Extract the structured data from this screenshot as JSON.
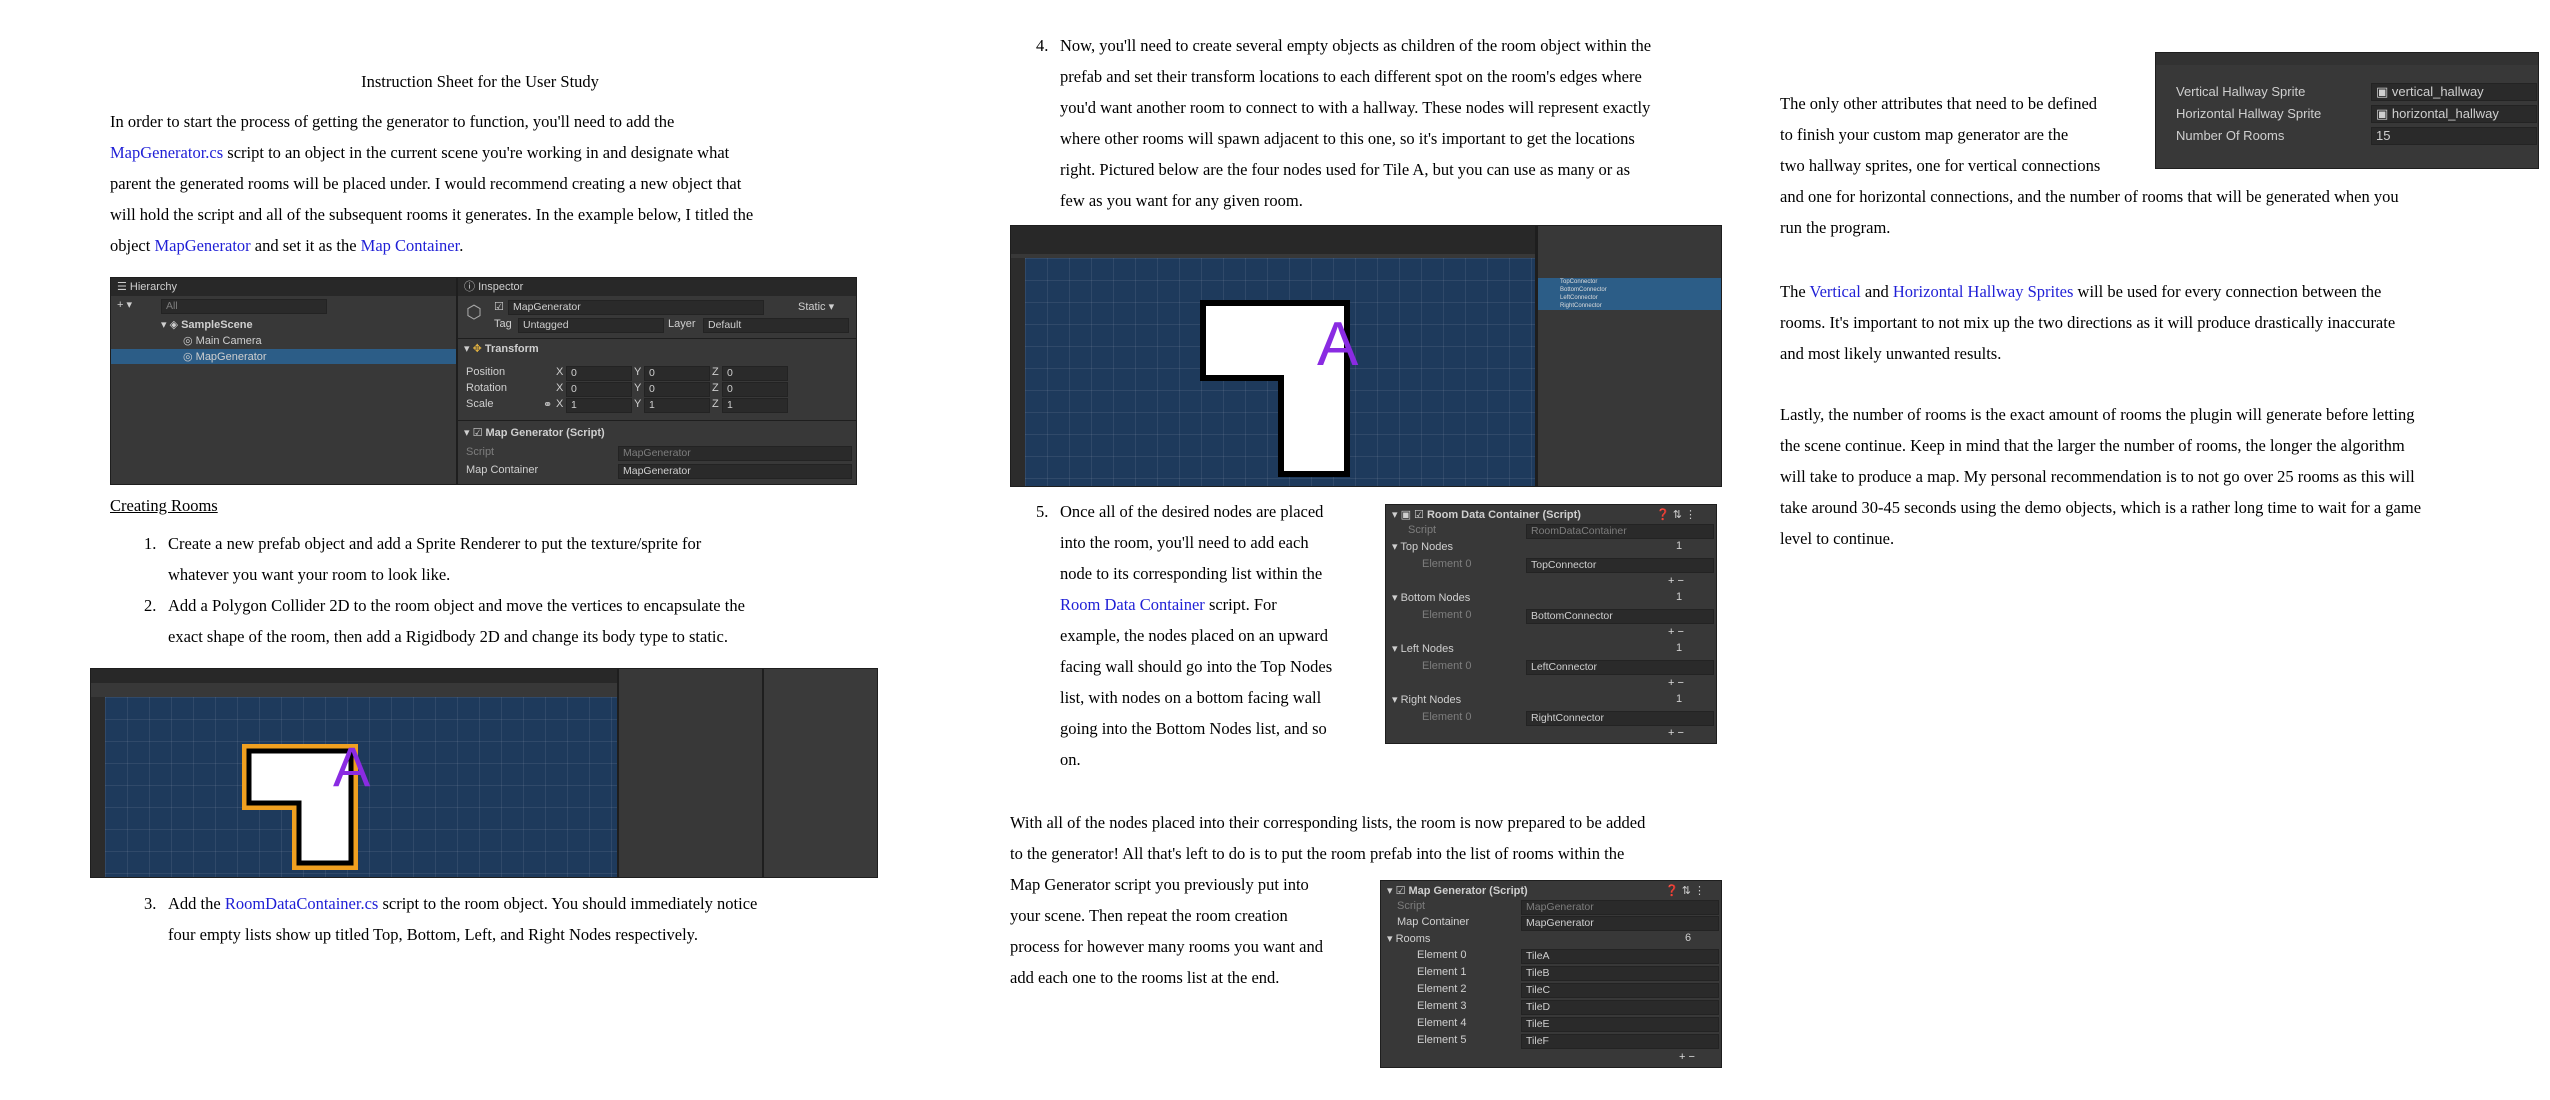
{
  "col1": {
    "title": "Instruction Sheet for the User Study",
    "intro": {
      "t1": "In order to start the process of getting the generator to function, you'll need to add the",
      "link1": "MapGenerator.cs",
      "t2": " script to an object in the current scene you're working in and designate what",
      "t3": "parent the generated rooms will be placed under. I would recommend creating a new object that",
      "t4": "will hold the script and all of the subsequent rooms it generates. In the example below, I titled the",
      "t5a": "object ",
      "link2": "MapGenerator",
      "t5b": " and set it as the ",
      "link3": "Map Container",
      "t5c": "."
    },
    "unity1": {
      "hierarchy_tab": "Hierarchy",
      "search": "All",
      "scene": "SampleScene",
      "items": [
        "Main Camera",
        "MapGenerator"
      ],
      "inspector_tab": "Inspector",
      "object_name": "MapGenerator",
      "static": "Static",
      "tag_label": "Tag",
      "tag_value": "Untagged",
      "layer_label": "Layer",
      "layer_value": "Default",
      "transform": "Transform",
      "rows": [
        {
          "label": "Position",
          "x": "0",
          "y": "0",
          "z": "0"
        },
        {
          "label": "Rotation",
          "x": "0",
          "y": "0",
          "z": "0"
        },
        {
          "label": "Scale",
          "x": "1",
          "y": "1",
          "z": "1"
        }
      ],
      "component": "Map Generator (Script)",
      "script_label": "Script",
      "script_value": "MapGenerator",
      "container_label": "Map Container",
      "container_value": "MapGenerator"
    },
    "creating_rooms": "Creating Rooms",
    "steps": {
      "n1": "1.",
      "s1a": "Create a new prefab object and add a Sprite Renderer to put the texture/sprite for",
      "s1b": "whatever you want your room to look like.",
      "n2": "2.",
      "s2a": "Add a Polygon Collider 2D to the room object and move the vertices to encapsulate the",
      "s2b": "exact shape of the room, then add a Rigidbody 2D and change its body type to static.",
      "n3": "3.",
      "s3a_pre": "Add the ",
      "s3a_link": "RoomDataContainer.cs",
      "s3a_post": " script to the room object. You should immediately notice",
      "s3b": "four empty lists show up titled Top, Bottom, Left, and Right Nodes respectively."
    },
    "room_letter": "A"
  },
  "col2": {
    "n4": "4.",
    "s4": [
      "Now, you'll need to create several empty objects as children of the room object within the",
      "prefab and set their transform locations to each different spot on the room's edges where",
      "you'd want another room to connect to with a hallway. These nodes will represent exactly",
      "where other rooms will spawn adjacent to this one, so it's important to get the locations",
      "right. Pictured below are the four nodes used for Tile A, but you can use as many or as",
      "few as you want for any given room."
    ],
    "hierarchy_nodes": [
      "TopConnector",
      "BottomConnector",
      "LeftConnector",
      "RightConnector"
    ],
    "n5": "5.",
    "s5a": "Once all of the desired nodes are placed",
    "s5b": "into the room, you'll need to add each",
    "s5c": "node to its corresponding list within the",
    "s5d_link": "Room Data Container",
    "s5d_post": " script. For",
    "s5e": "example, the nodes placed on an upward",
    "s5f": "facing wall should go into the Top Nodes",
    "s5g": "list, with nodes on a bottom facing wall",
    "s5h": "going into the Bottom Nodes list, and so",
    "s5i": "on.",
    "rdc": {
      "title": "Room Data Container (Script)",
      "script_label": "Script",
      "script_value": "RoomDataContainer",
      "groups": [
        {
          "name": "Top Nodes",
          "count": "1",
          "elem": "Element 0",
          "value": "TopConnector"
        },
        {
          "name": "Bottom Nodes",
          "count": "1",
          "elem": "Element 0",
          "value": "BottomConnector"
        },
        {
          "name": "Left Nodes",
          "count": "1",
          "elem": "Element 0",
          "value": "LeftConnector"
        },
        {
          "name": "Right Nodes",
          "count": "1",
          "elem": "Element 0",
          "value": "RightConnector"
        }
      ]
    },
    "final": [
      "With all of the nodes placed into their corresponding lists, the room is now prepared to be added",
      "to the generator! All that's left to do is to put the room prefab into the list of rooms within the",
      "Map Generator script you previously put into",
      "your scene. Then repeat the room creation",
      "process for however many rooms you want and",
      "add each one to the rooms list at the end."
    ],
    "mg": {
      "title": "Map Generator (Script)",
      "script_label": "Script",
      "script_value": "MapGenerator",
      "container_label": "Map Container",
      "container_value": "MapGenerator",
      "rooms_label": "Rooms",
      "rooms_count": "6",
      "rooms": [
        {
          "elem": "Element 0",
          "value": "TileA"
        },
        {
          "elem": "Element 1",
          "value": "TileB"
        },
        {
          "elem": "Element 2",
          "value": "TileC"
        },
        {
          "elem": "Element 3",
          "value": "TileD"
        },
        {
          "elem": "Element 4",
          "value": "TileE"
        },
        {
          "elem": "Element 5",
          "value": "TileF"
        }
      ]
    }
  },
  "col3": {
    "p1": [
      "The only other attributes that need to be defined",
      "to finish your custom map generator are the",
      "two hallway sprites, one for vertical connections",
      "and one for horizontal connections, and the number of rooms that will be generated when you",
      "run the program."
    ],
    "panel": {
      "rows": [
        {
          "label": "Vertical Hallway Sprite",
          "value": "vertical_hallway"
        },
        {
          "label": "Horizontal Hallway Sprite",
          "value": "horizontal_hallway"
        },
        {
          "label": "Number Of Rooms",
          "value": "15"
        }
      ]
    },
    "p2": {
      "a": "The ",
      "link1": "Vertical",
      "b": " and ",
      "link2": "Horizontal Hallway Sprites",
      "c": " will be used for every connection between the",
      "l2": "rooms. It's important to not mix up the two directions as it will produce drastically inaccurate",
      "l3": "and most likely unwanted results."
    },
    "p3": [
      "Lastly, the number of rooms is the exact amount of rooms the plugin will generate before letting",
      "the scene continue. Keep in mind that the larger the number of rooms, the longer the algorithm",
      "will take to produce a map. My personal recommendation is to not go over 25 rooms as this will",
      "take around 30-45 seconds using the demo objects, which is a rather long time to wait for a game",
      "level to continue."
    ]
  }
}
